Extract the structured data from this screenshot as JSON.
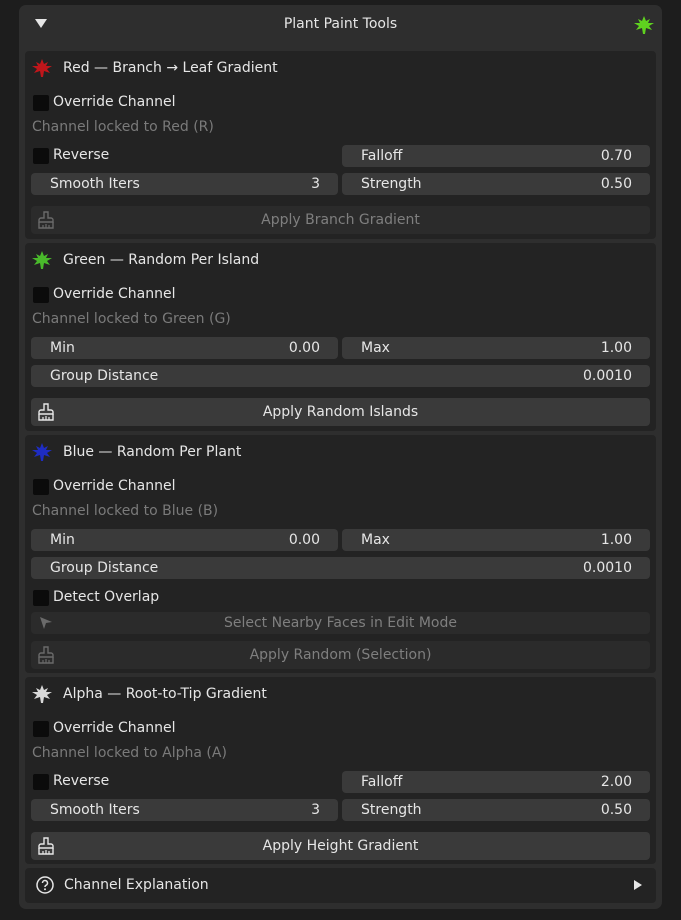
{
  "header": {
    "title": "Plant Paint Tools",
    "icon": "green-leaf-icon"
  },
  "red": {
    "title": "Red — Branch → Leaf Gradient",
    "icon_color": "#c0161b",
    "override_label": "Override Channel",
    "hint": "Channel locked to Red (R)",
    "reverse_label": "Reverse",
    "falloff_label": "Falloff",
    "falloff_value": "0.70",
    "smooth_label": "Smooth Iters",
    "smooth_value": "3",
    "strength_label": "Strength",
    "strength_value": "0.50",
    "button": "Apply Branch Gradient"
  },
  "green": {
    "title": "Green — Random Per Island",
    "icon_color": "#49b92b",
    "override_label": "Override Channel",
    "hint": "Channel locked to Green (G)",
    "min_label": "Min",
    "min_value": "0.00",
    "max_label": "Max",
    "max_value": "1.00",
    "group_label": "Group Distance",
    "group_value": "0.0010",
    "button": "Apply Random Islands"
  },
  "blue": {
    "title": "Blue — Random Per Plant",
    "icon_color": "#1e2cc2",
    "override_label": "Override Channel",
    "hint": "Channel locked to Blue (B)",
    "min_label": "Min",
    "min_value": "0.00",
    "max_label": "Max",
    "max_value": "1.00",
    "group_label": "Group Distance",
    "group_value": "0.0010",
    "detect_label": "Detect Overlap",
    "select_button": "Select Nearby Faces in Edit Mode",
    "button": "Apply Random (Selection)"
  },
  "alpha": {
    "title": "Alpha — Root-to-Tip Gradient",
    "icon_color": "#d8d8d8",
    "override_label": "Override Channel",
    "hint": "Channel locked to Alpha (A)",
    "reverse_label": "Reverse",
    "falloff_label": "Falloff",
    "falloff_value": "2.00",
    "smooth_label": "Smooth Iters",
    "smooth_value": "3",
    "strength_label": "Strength",
    "strength_value": "0.50",
    "button": "Apply Height Gradient"
  },
  "footer": {
    "label": "Channel Explanation"
  }
}
